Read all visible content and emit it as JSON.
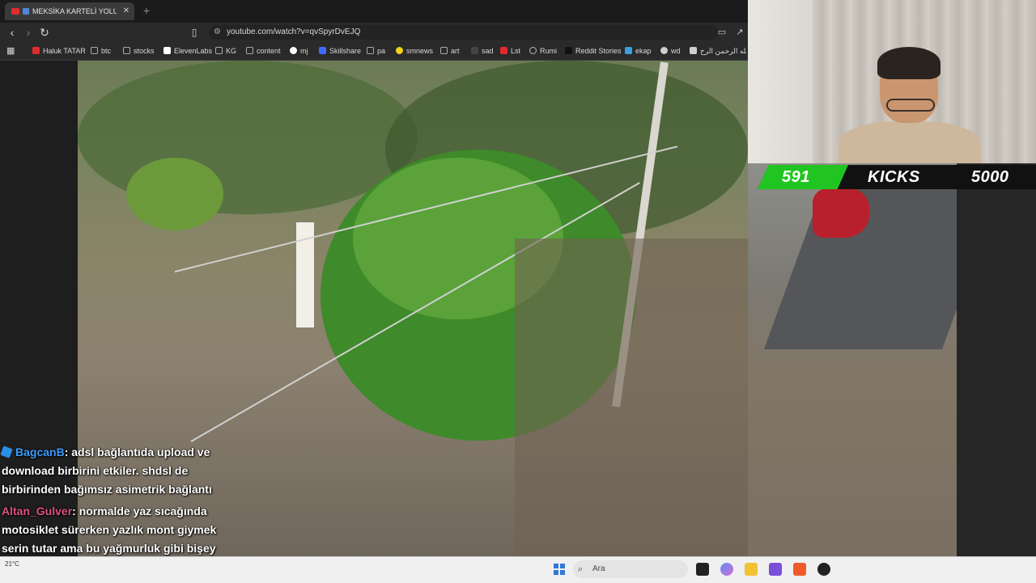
{
  "browser": {
    "tab": {
      "title": "MEKSİKA KARTELİ YOLUMUZU KESTİ",
      "close": "✕"
    },
    "new_tab": "+",
    "url": "youtube.com/watch?v=qvSpyrDvEJQ",
    "bookmarks": [
      {
        "label": "Haluk TATAR",
        "color": "#e02b2b"
      },
      {
        "label": "btc",
        "color": "#a0a0a0"
      },
      {
        "label": "stocks",
        "color": "#a0a0a0"
      },
      {
        "label": "ElevenLabs",
        "color": "#ffffff"
      },
      {
        "label": "KG",
        "color": "#a0a0a0"
      },
      {
        "label": "content",
        "color": "#a0a0a0"
      },
      {
        "label": "mj",
        "color": "#ffffff"
      },
      {
        "label": "Skillshare",
        "color": "#3b6cff"
      },
      {
        "label": "pa",
        "color": "#a0a0a0"
      },
      {
        "label": "smnews",
        "color": "#f2d21b"
      },
      {
        "label": "art",
        "color": "#a0a0a0"
      },
      {
        "label": "sad",
        "color": "#ffffff"
      },
      {
        "label": "Lst",
        "color": "#e02b2b"
      },
      {
        "label": "Rumi",
        "color": "#a0a0a0"
      },
      {
        "label": "Reddit Stories",
        "color": "#222222"
      },
      {
        "label": "ekap",
        "color": "#3aa0e0"
      },
      {
        "label": "wd",
        "color": "#cfcfcf"
      },
      {
        "label": "الله الرحمن الرح...",
        "color": "#cfcfcf"
      }
    ]
  },
  "stream_overlay": {
    "current_count": "591",
    "label": "KICKS",
    "goal": "5000",
    "accent_color": "#21c521"
  },
  "chat": [
    {
      "user": "BagcanB",
      "text": ": adsl bağlantıda upload ve download birbirini etkiler. shdsl de birbirinden bağımsız asimetrik bağlantı"
    },
    {
      "user": "Altan_Gulver",
      "text": ": normalde yaz sıcağında motosiklet sürerken yazlık mont giymek serin tutar ama bu yağmurluk gibi bişey giymiş üstüne :D"
    }
  ],
  "taskbar": {
    "weather_temp": "21°C",
    "search_placeholder": "Ara"
  }
}
